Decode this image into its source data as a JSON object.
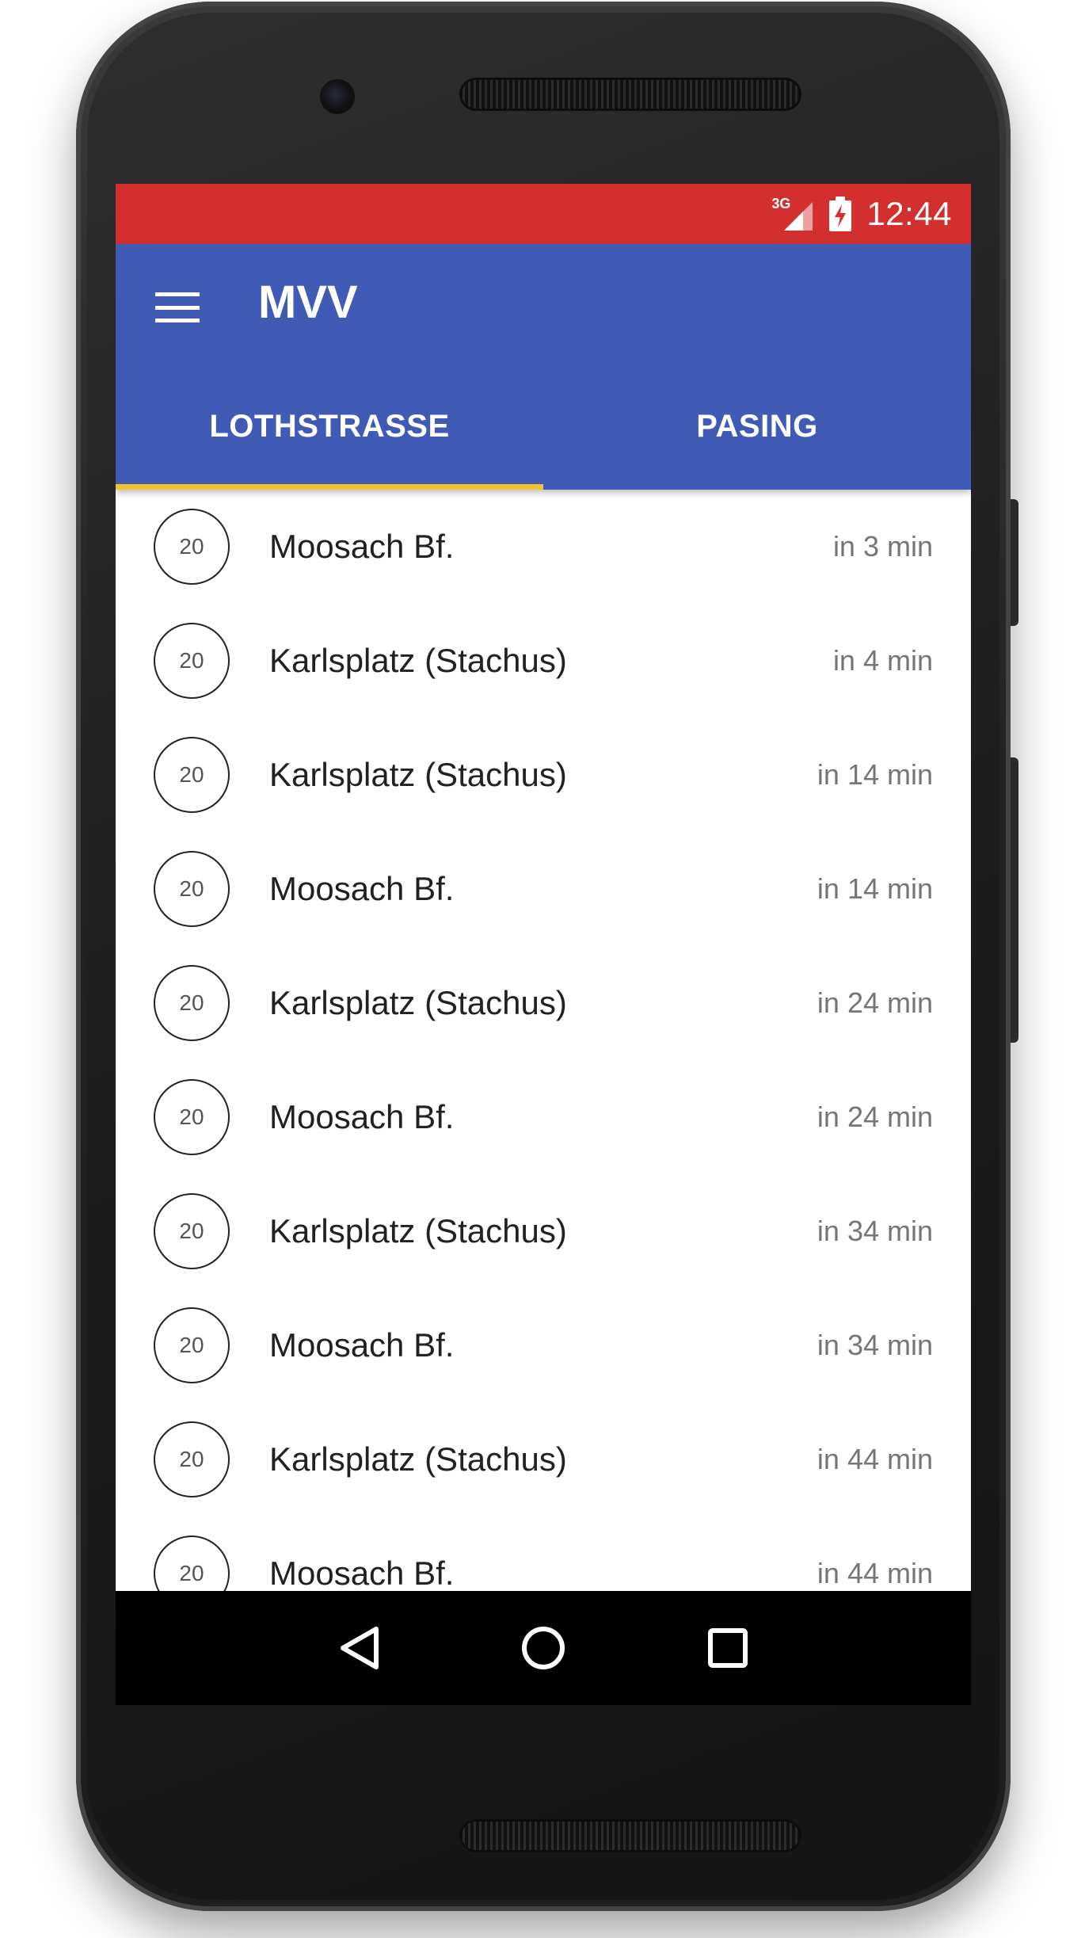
{
  "status_bar": {
    "network": "3G",
    "time": "12:44",
    "color": "#d32f2f"
  },
  "app_bar": {
    "title": "MVV",
    "color": "#3f5bb6",
    "tabs": [
      {
        "label": "LOTHSTRASSE",
        "selected": true
      },
      {
        "label": "PASING",
        "selected": false
      }
    ],
    "indicator_color": "#f2c12e"
  },
  "departures": [
    {
      "line": "20",
      "destination": "Moosach Bf.",
      "eta": "in 3 min"
    },
    {
      "line": "20",
      "destination": "Karlsplatz (Stachus)",
      "eta": "in 4 min"
    },
    {
      "line": "20",
      "destination": "Karlsplatz (Stachus)",
      "eta": "in 14 min"
    },
    {
      "line": "20",
      "destination": "Moosach Bf.",
      "eta": "in 14 min"
    },
    {
      "line": "20",
      "destination": "Karlsplatz (Stachus)",
      "eta": "in 24 min"
    },
    {
      "line": "20",
      "destination": "Moosach Bf.",
      "eta": "in 24 min"
    },
    {
      "line": "20",
      "destination": "Karlsplatz (Stachus)",
      "eta": "in 34 min"
    },
    {
      "line": "20",
      "destination": "Moosach Bf.",
      "eta": "in 34 min"
    },
    {
      "line": "20",
      "destination": "Karlsplatz (Stachus)",
      "eta": "in 44 min"
    },
    {
      "line": "20",
      "destination": "Moosach Bf.",
      "eta": "in 44 min"
    }
  ],
  "nav_bar": {
    "buttons": [
      "back-icon",
      "home-icon",
      "recents-icon"
    ]
  }
}
